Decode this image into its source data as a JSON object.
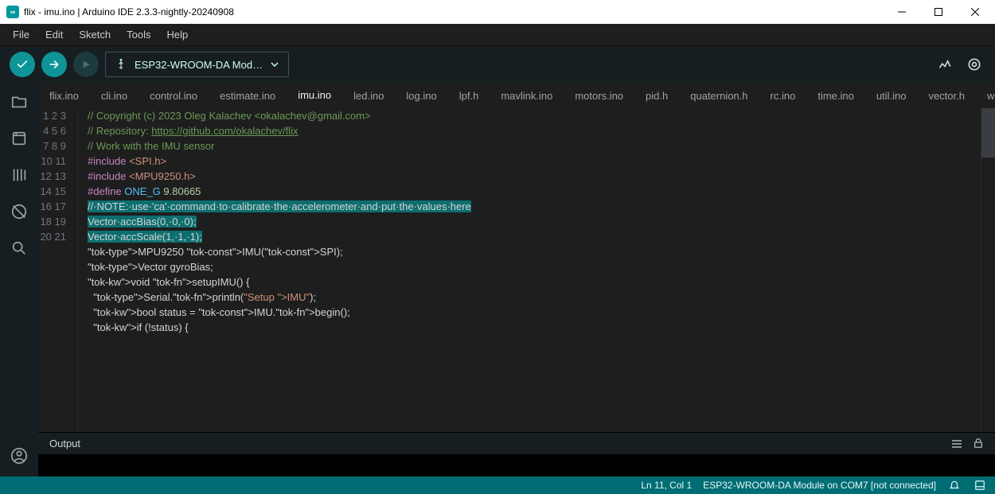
{
  "window": {
    "title": "flix - imu.ino | Arduino IDE 2.3.3-nightly-20240908"
  },
  "menubar": [
    "File",
    "Edit",
    "Sketch",
    "Tools",
    "Help"
  ],
  "board": {
    "label": "ESP32-WROOM-DA Mod…"
  },
  "tabs": [
    "flix.ino",
    "cli.ino",
    "control.ino",
    "estimate.ino",
    "imu.ino",
    "led.ino",
    "log.ino",
    "lpf.h",
    "mavlink.ino",
    "motors.ino",
    "pid.h",
    "quaternion.h",
    "rc.ino",
    "time.ino",
    "util.ino",
    "vector.h",
    "wifi.ino"
  ],
  "active_tab": 4,
  "code": {
    "lines": [
      "// Copyright (c) 2023 Oleg Kalachev <okalachev@gmail.com>",
      "// Repository: https://github.com/okalachev/flix",
      "",
      "// Work with the IMU sensor",
      "",
      "#include <SPI.h>",
      "#include <MPU9250.h>",
      "",
      "#define ONE_G 9.80665",
      "",
      "//·NOTE:·use·'ca'·command·to·calibrate·the·accelerometer·and·put·the·values·here",
      "Vector·accBias(0,·0,·0);",
      "Vector·accScale(1,·1,·1);",
      "",
      "MPU9250 IMU(SPI);",
      "Vector gyroBias;",
      "",
      "void setupIMU() {",
      "  Serial.println(\"Setup IMU\");",
      "  bool status = IMU.begin();",
      "  if (!status) {"
    ],
    "selected_lines": [
      11,
      12,
      13
    ]
  },
  "panel": {
    "title": "Output"
  },
  "status": {
    "cursor": "Ln 11, Col 1",
    "board": "ESP32-WROOM-DA Module on COM7 [not connected]"
  }
}
